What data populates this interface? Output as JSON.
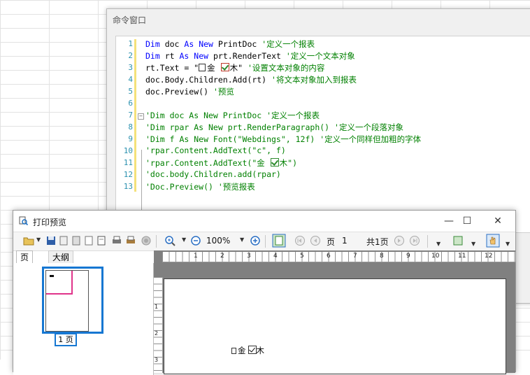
{
  "command_window": {
    "title": "命令窗口",
    "lines": [
      {
        "n": "1"
      },
      {
        "n": "2"
      },
      {
        "n": "3"
      },
      {
        "n": "4"
      },
      {
        "n": "5"
      },
      {
        "n": "6"
      },
      {
        "n": "7"
      },
      {
        "n": "8"
      },
      {
        "n": "9"
      },
      {
        "n": "10"
      },
      {
        "n": "11"
      },
      {
        "n": "12"
      },
      {
        "n": "13"
      }
    ],
    "code": {
      "l1_kw1": "Dim",
      "l1_a": " doc ",
      "l1_kw2": "As",
      "l1_sp": " ",
      "l1_kw3": "New",
      "l1_b": " PrintDoc ",
      "l1_c": "'定义一个报表",
      "l2_kw1": "Dim",
      "l2_a": " rt ",
      "l2_kw2": "As",
      "l2_sp": " ",
      "l2_kw3": "New",
      "l2_b": " prt.RenderText ",
      "l2_c": "'定义一个文本对象",
      "l3_a": "rt.Text = \"",
      "l3_b": "金 ",
      "l3_c": "木\"",
      "l3_d": " '设置文本对象的内容",
      "l4_a": "doc.Body.Children.Add(rt) ",
      "l4_c": "'将文本对象加入到报表",
      "l5_a": "doc.Preview() ",
      "l5_c": "'预览",
      "l7": "'Dim doc As New PrintDoc '定义一个报表",
      "l8": "'Dim rpar As New prt.RenderParagraph() '定义一个段落对象",
      "l9": "'Dim f As New Font(\"Webdings\", 12f) '定义一个同样但加粗的字体",
      "l10": "'rpar.Content.AddText(\"c\", f)",
      "l11a": "'rpar.Content.AddText(\"金 ",
      "l11b": "木\")",
      "l12": "'doc.body.Children.add(rpar)",
      "l13": "'Doc.Preview() '预览报表"
    }
  },
  "preview_window": {
    "title": "打印预览",
    "window_buttons": {
      "minimize": "—",
      "maximize": "☐",
      "close": "✕"
    },
    "toolbar": {
      "zoom_value": "100%",
      "page_label": "页",
      "page_value": "1",
      "page_total": "共1页"
    },
    "nav_tabs": {
      "page": "页",
      "outline": "大纲"
    },
    "thumbnail_label": "1 页",
    "ruler_h_labels": [
      "1",
      "2",
      "3",
      "4",
      "5",
      "6",
      "7",
      "8",
      "9",
      "10",
      "11",
      "12"
    ],
    "ruler_v_labels": [
      "1",
      "2",
      "3"
    ],
    "page_text": {
      "a": "金",
      "b": "木"
    }
  },
  "colors": {
    "keyword": "#0000ff",
    "comment": "#008000",
    "line_number": "#2b91af",
    "highlight_frame": "#1677d2",
    "margin": "#e0338a"
  }
}
